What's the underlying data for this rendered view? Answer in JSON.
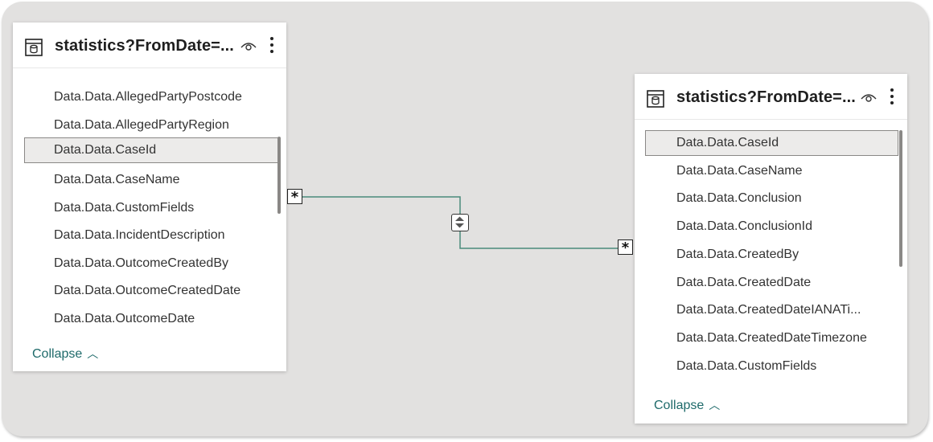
{
  "colors": {
    "canvas_bg": "#e2e1e0",
    "connector": "#4a8a7a",
    "collapse_link": "#1e6a6a",
    "selected_row_bg": "#ecebea"
  },
  "left_table": {
    "title": "statistics?FromDate=...",
    "icon": "table-icon",
    "fields": [
      "Data.Data.AllegedPartyPostcode",
      "Data.Data.AllegedPartyRegion",
      "Data.Data.CaseId",
      "Data.Data.CaseName",
      "Data.Data.CustomFields",
      "Data.Data.IncidentDescription",
      "Data.Data.OutcomeCreatedBy",
      "Data.Data.OutcomeCreatedDate",
      "Data.Data.OutcomeDate"
    ],
    "selected_field": "Data.Data.CaseId",
    "collapse_label": "Collapse"
  },
  "right_table": {
    "title": "statistics?FromDate=...",
    "icon": "table-icon",
    "fields": [
      "Data.Data.CaseId",
      "Data.Data.CaseName",
      "Data.Data.Conclusion",
      "Data.Data.ConclusionId",
      "Data.Data.CreatedBy",
      "Data.Data.CreatedDate",
      "Data.Data.CreatedDateIANATi...",
      "Data.Data.CreatedDateTimezone",
      "Data.Data.CustomFields"
    ],
    "selected_field": "Data.Data.CaseId",
    "collapse_label": "Collapse"
  },
  "relationship": {
    "from_cardinality": "*",
    "to_cardinality": "*",
    "cross_filter": "both"
  }
}
